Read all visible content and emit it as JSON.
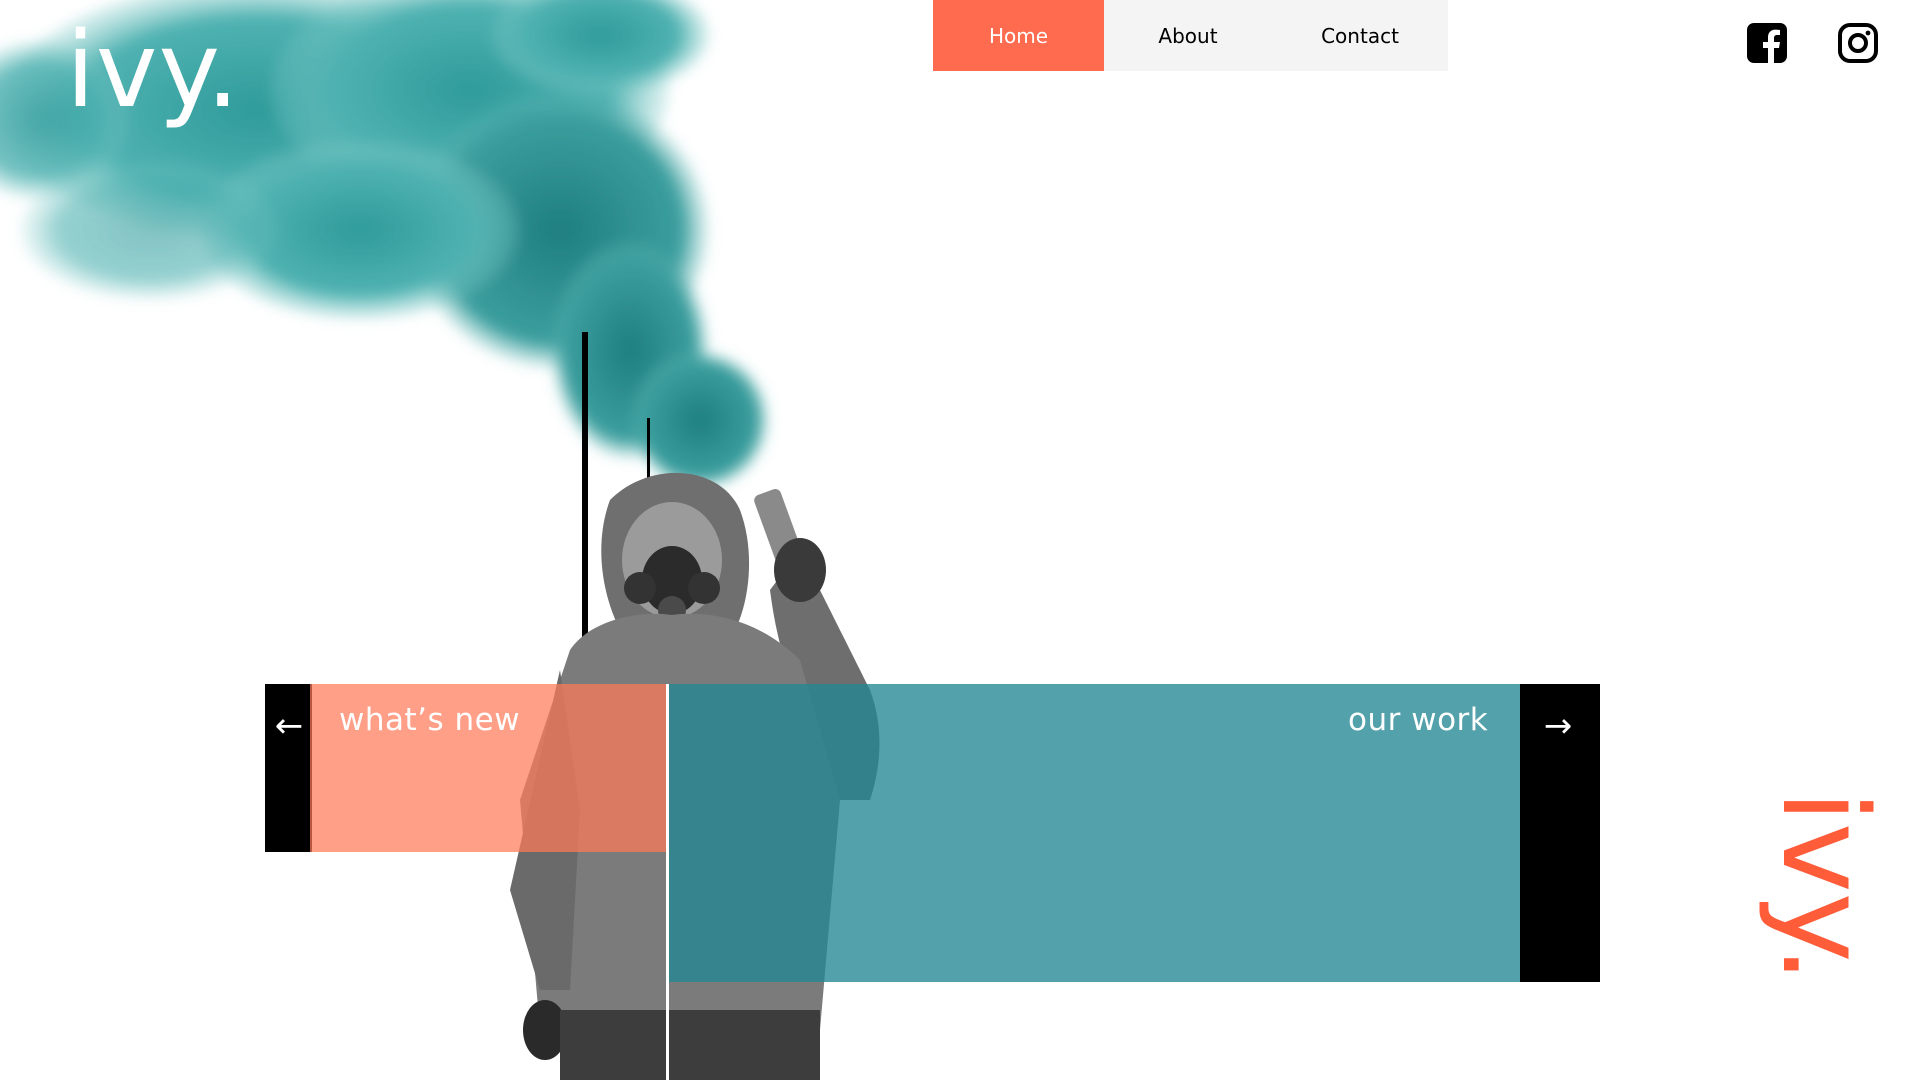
{
  "brand": {
    "logo": "ivy.",
    "side_logo": "ivy."
  },
  "nav": {
    "items": [
      {
        "label": "Home",
        "active": true
      },
      {
        "label": "About",
        "active": false
      },
      {
        "label": "Contact",
        "active": false
      }
    ]
  },
  "social": {
    "icons": [
      "facebook-icon",
      "instagram-icon"
    ]
  },
  "panels": {
    "left_label": "what’s new",
    "right_label": "our work",
    "left_arrow": "←",
    "right_arrow": "→"
  },
  "colors": {
    "accent": "#ff6b4f",
    "teal": "#2a8b98",
    "smoke": "#3fa7a6",
    "black": "#000000"
  }
}
